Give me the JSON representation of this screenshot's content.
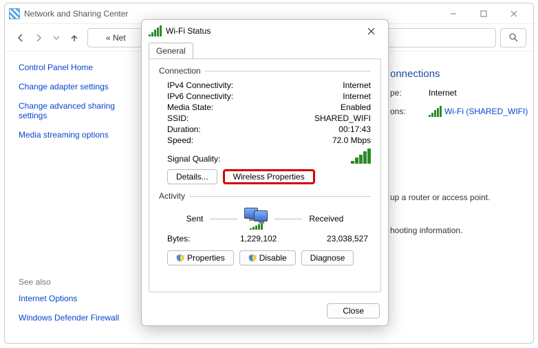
{
  "parent": {
    "title": "Network and Sharing Center",
    "address_prefix": "« Net",
    "left": {
      "home": "Control Panel Home",
      "adapter": "Change adapter settings",
      "advanced": "Change advanced sharing settings",
      "media": "Media streaming options",
      "see_also": "See also",
      "internet_options": "Internet Options",
      "firewall": "Windows Defender Firewall"
    },
    "right": {
      "heading": "onnections",
      "type_label": "pe:",
      "type_value": "Internet",
      "conn_label": "ons:",
      "conn_value": "Wi-Fi (SHARED_WIFI)",
      "text1": "up a router or access point.",
      "text2": "hooting information."
    }
  },
  "dialog": {
    "title": "Wi-Fi Status",
    "tab": "General",
    "groups": {
      "connection": "Connection",
      "activity": "Activity"
    },
    "conn": {
      "ipv4_k": "IPv4 Connectivity:",
      "ipv4_v": "Internet",
      "ipv6_k": "IPv6 Connectivity:",
      "ipv6_v": "Internet",
      "media_k": "Media State:",
      "media_v": "Enabled",
      "ssid_k": "SSID:",
      "ssid_v": "SHARED_WIFI",
      "duration_k": "Duration:",
      "duration_v": "00:17:43",
      "speed_k": "Speed:",
      "speed_v": "72.0 Mbps",
      "signal_k": "Signal Quality:"
    },
    "buttons": {
      "details": "Details...",
      "wireless": "Wireless Properties",
      "properties": "Properties",
      "disable": "Disable",
      "diagnose": "Diagnose",
      "close": "Close"
    },
    "activity": {
      "sent": "Sent",
      "received": "Received",
      "bytes_k": "Bytes:",
      "bytes_sent": "1,229,102",
      "bytes_recv": "23,038,527"
    }
  }
}
